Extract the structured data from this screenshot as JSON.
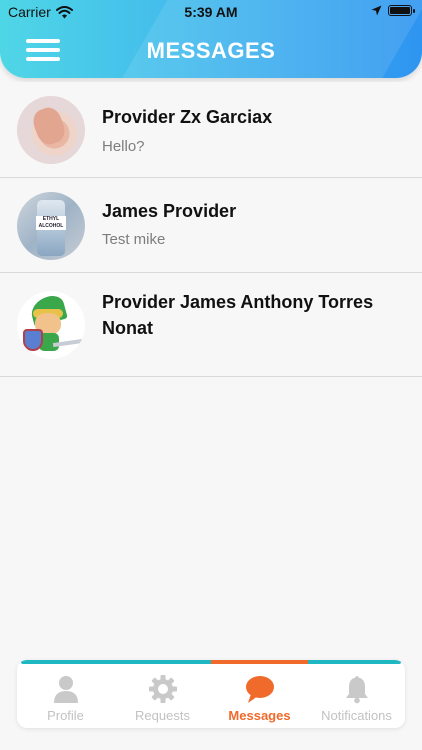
{
  "status_bar": {
    "carrier": "Carrier",
    "time": "5:39 AM",
    "icons": [
      "wifi-icon",
      "location-arrow-icon",
      "battery-icon"
    ]
  },
  "header": {
    "title": "MESSAGES",
    "menu_icon": "hamburger-menu-icon",
    "gradient_colors": [
      "#4fd6e6",
      "#2e95f0"
    ]
  },
  "conversations": [
    {
      "name": "Provider Zx Garciax",
      "preview": "Hello?",
      "avatar": "photo-foot"
    },
    {
      "name": "James Provider",
      "preview": "Test mike",
      "avatar": "photo-alcohol-bottle",
      "avatar_text": "ETHYL ALCOHOL"
    },
    {
      "name": "Provider James Anthony Torres Nonat",
      "preview": "",
      "avatar": "photo-cartoon-link"
    }
  ],
  "tabbar": {
    "active_color": "#f06a2c",
    "bar_color": "#1fb8c2",
    "inactive_color": "#c2c2c2",
    "tabs": [
      {
        "label": "Profile",
        "icon": "person-icon",
        "active": false
      },
      {
        "label": "Requests",
        "icon": "gear-icon",
        "active": false
      },
      {
        "label": "Messages",
        "icon": "chat-bubble-icon",
        "active": true
      },
      {
        "label": "Notifications",
        "icon": "bell-icon",
        "active": false
      }
    ]
  }
}
